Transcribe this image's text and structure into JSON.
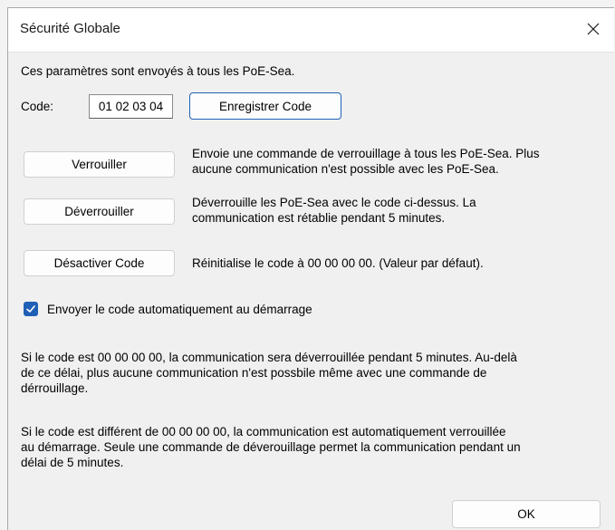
{
  "window": {
    "title": "Sécurité Globale",
    "close_icon": "close-icon"
  },
  "intro": "Ces paramètres sont envoyés à tous les PoE-Sea.",
  "code": {
    "label": "Code:",
    "value": "01 02 03 04",
    "save_button": "Enregistrer Code"
  },
  "actions": [
    {
      "button": "Verrouiller",
      "desc_line1": "Envoie une commande de verrouillage à tous les PoE-Sea. Plus",
      "desc_line2": "aucune communication n'est possible avec les PoE-Sea."
    },
    {
      "button": "Déverrouiller",
      "desc_line1": "Déverrouille les PoE-Sea avec le code ci-dessus. La",
      "desc_line2": "communication est rétablie pendant 5 minutes."
    },
    {
      "button": "Désactiver Code",
      "desc_line1": "Réinitialise le code à 00 00 00 00. (Valeur par défaut)."
    }
  ],
  "auto_send": {
    "checked": true,
    "label": "Envoyer le code automatiquement au démarrage"
  },
  "info1": {
    "line1": "Si le code est 00 00 00 00, la communication sera déverrouillée pendant 5 minutes. Au-delà",
    "line2": "de ce délai, plus aucune communication n'est possbile même avec une commande de",
    "line3": "dérrouillage."
  },
  "info2": {
    "line1": "Si le code est différent de 00 00 00 00, la communication est automatiquement verrouillée",
    "line2": "au démarrage. Seule une commande de déverouillage permet la communication pendant un",
    "line3": "délai de 5 minutes."
  },
  "ok_button": "OK",
  "colors": {
    "accent": "#1f5fb5",
    "dialog_bg": "#f0f0f0",
    "titlebar_bg": "#ffffff"
  }
}
